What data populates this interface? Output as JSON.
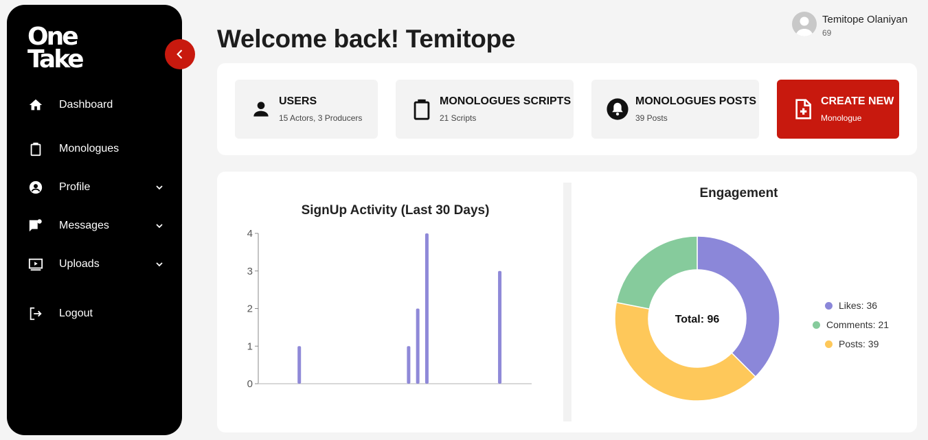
{
  "sidebar": {
    "logo": [
      "One",
      "Take"
    ],
    "items": [
      {
        "label": "Dashboard",
        "icon": "home-icon"
      },
      {
        "label": "Monologues",
        "icon": "clipboard-icon"
      },
      {
        "label": "Profile",
        "icon": "account-circle-icon"
      },
      {
        "label": "Messages",
        "icon": "chat-bubble-icon"
      },
      {
        "label": "Uploads",
        "icon": "video-play-icon"
      },
      {
        "label": "Logout",
        "icon": "logout-icon"
      }
    ]
  },
  "header": {
    "title": "Welcome back! Temitope",
    "user_name": "Temitope Olaniyan",
    "user_sub": "69"
  },
  "stats": [
    {
      "title": "USERS",
      "sub": "15 Actors, 3 Producers",
      "icon": "person-icon"
    },
    {
      "title": "MONOLOGUES SCRIPTS",
      "sub": "21 Scripts",
      "icon": "clipboard-icon"
    },
    {
      "title": "MONOLOGUES POSTS",
      "sub": "39 Posts",
      "icon": "bell-icon"
    },
    {
      "title": "CREATE NEW",
      "sub": "Monologue",
      "icon": "file-add-icon"
    }
  ],
  "colors": {
    "accent": "#c8190e",
    "sidebar_bg": "#000000",
    "bar": "#8f89d8",
    "likes": "#8b87d9",
    "comments": "#86cb9c",
    "posts": "#fec85a"
  },
  "chart_data": [
    {
      "type": "bar",
      "title": "SignUp Activity (Last 30 Days)",
      "xlabel": "",
      "ylabel": "",
      "ylim": [
        0,
        4
      ],
      "yticks": [
        0,
        1,
        2,
        3,
        4
      ],
      "x_count": 30,
      "x": [
        4,
        16,
        17,
        18,
        26
      ],
      "values": [
        1,
        1,
        2,
        4,
        3
      ],
      "grid": false
    },
    {
      "type": "pie",
      "title": "Engagement",
      "center_label": "Total: 96",
      "slices": [
        {
          "label": "Likes: 36",
          "value": 36
        },
        {
          "label": "Posts: 39",
          "value": 39
        },
        {
          "label": "Comments: 21",
          "value": 21
        }
      ],
      "legend": [
        "Likes: 36",
        "Comments: 21",
        "Posts: 39"
      ],
      "legend_position": "right"
    }
  ]
}
